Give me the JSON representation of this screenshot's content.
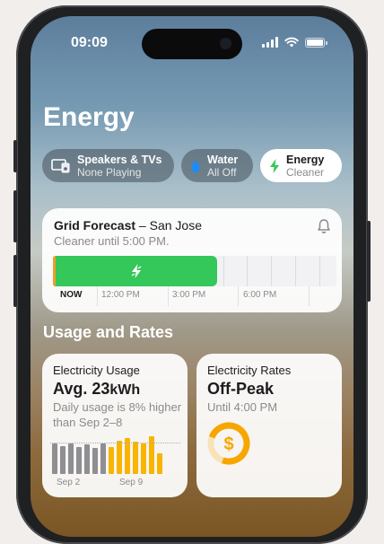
{
  "status_bar": {
    "time": "09:09"
  },
  "page": {
    "title": "Energy"
  },
  "categories": [
    {
      "title": "Speakers & TVs",
      "subtitle": "None Playing",
      "icon": "tv-speaker-icon"
    },
    {
      "title": "Water",
      "subtitle": "All Off",
      "icon": "water-drop-icon"
    },
    {
      "title": "Energy",
      "subtitle": "Cleaner",
      "icon": "bolt-icon",
      "selected": true
    }
  ],
  "grid_forecast": {
    "title": "Grid Forecast",
    "separator": " – ",
    "location": "San Jose",
    "subtitle": "Cleaner until 5:00 PM.",
    "time_labels": [
      "NOW",
      "12:00 PM",
      "3:00 PM",
      "6:00 PM"
    ],
    "clean_fraction": 0.58,
    "colors": {
      "clean": "#34c759",
      "now": "#f49b27"
    }
  },
  "usage_section": {
    "title": "Usage and Rates"
  },
  "electricity_usage": {
    "title": "Electricity Usage",
    "value_prefix": "Avg. 23",
    "unit": "kWh",
    "description": "Daily usage is 8% higher than Sep 2–8",
    "x_labels": [
      "Sep 2",
      "Sep 9"
    ],
    "chart_data": {
      "type": "bar",
      "series": [
        {
          "values": [
            0.8,
            0.75,
            0.82,
            0.72,
            0.78,
            0.7,
            0.8
          ],
          "color": "#8e8e93"
        },
        {
          "values": [
            0.72,
            0.88,
            0.95,
            0.85,
            0.8,
            1.0,
            0.55
          ],
          "color": "#f7b500"
        }
      ],
      "average": 0.8
    }
  },
  "electricity_rates": {
    "title": "Electricity Rates",
    "rate": "Off-Peak",
    "subtitle": "Until 4:00 PM",
    "icon": "dollar-gauge-icon",
    "colors": {
      "gauge": "#f7a600"
    }
  }
}
